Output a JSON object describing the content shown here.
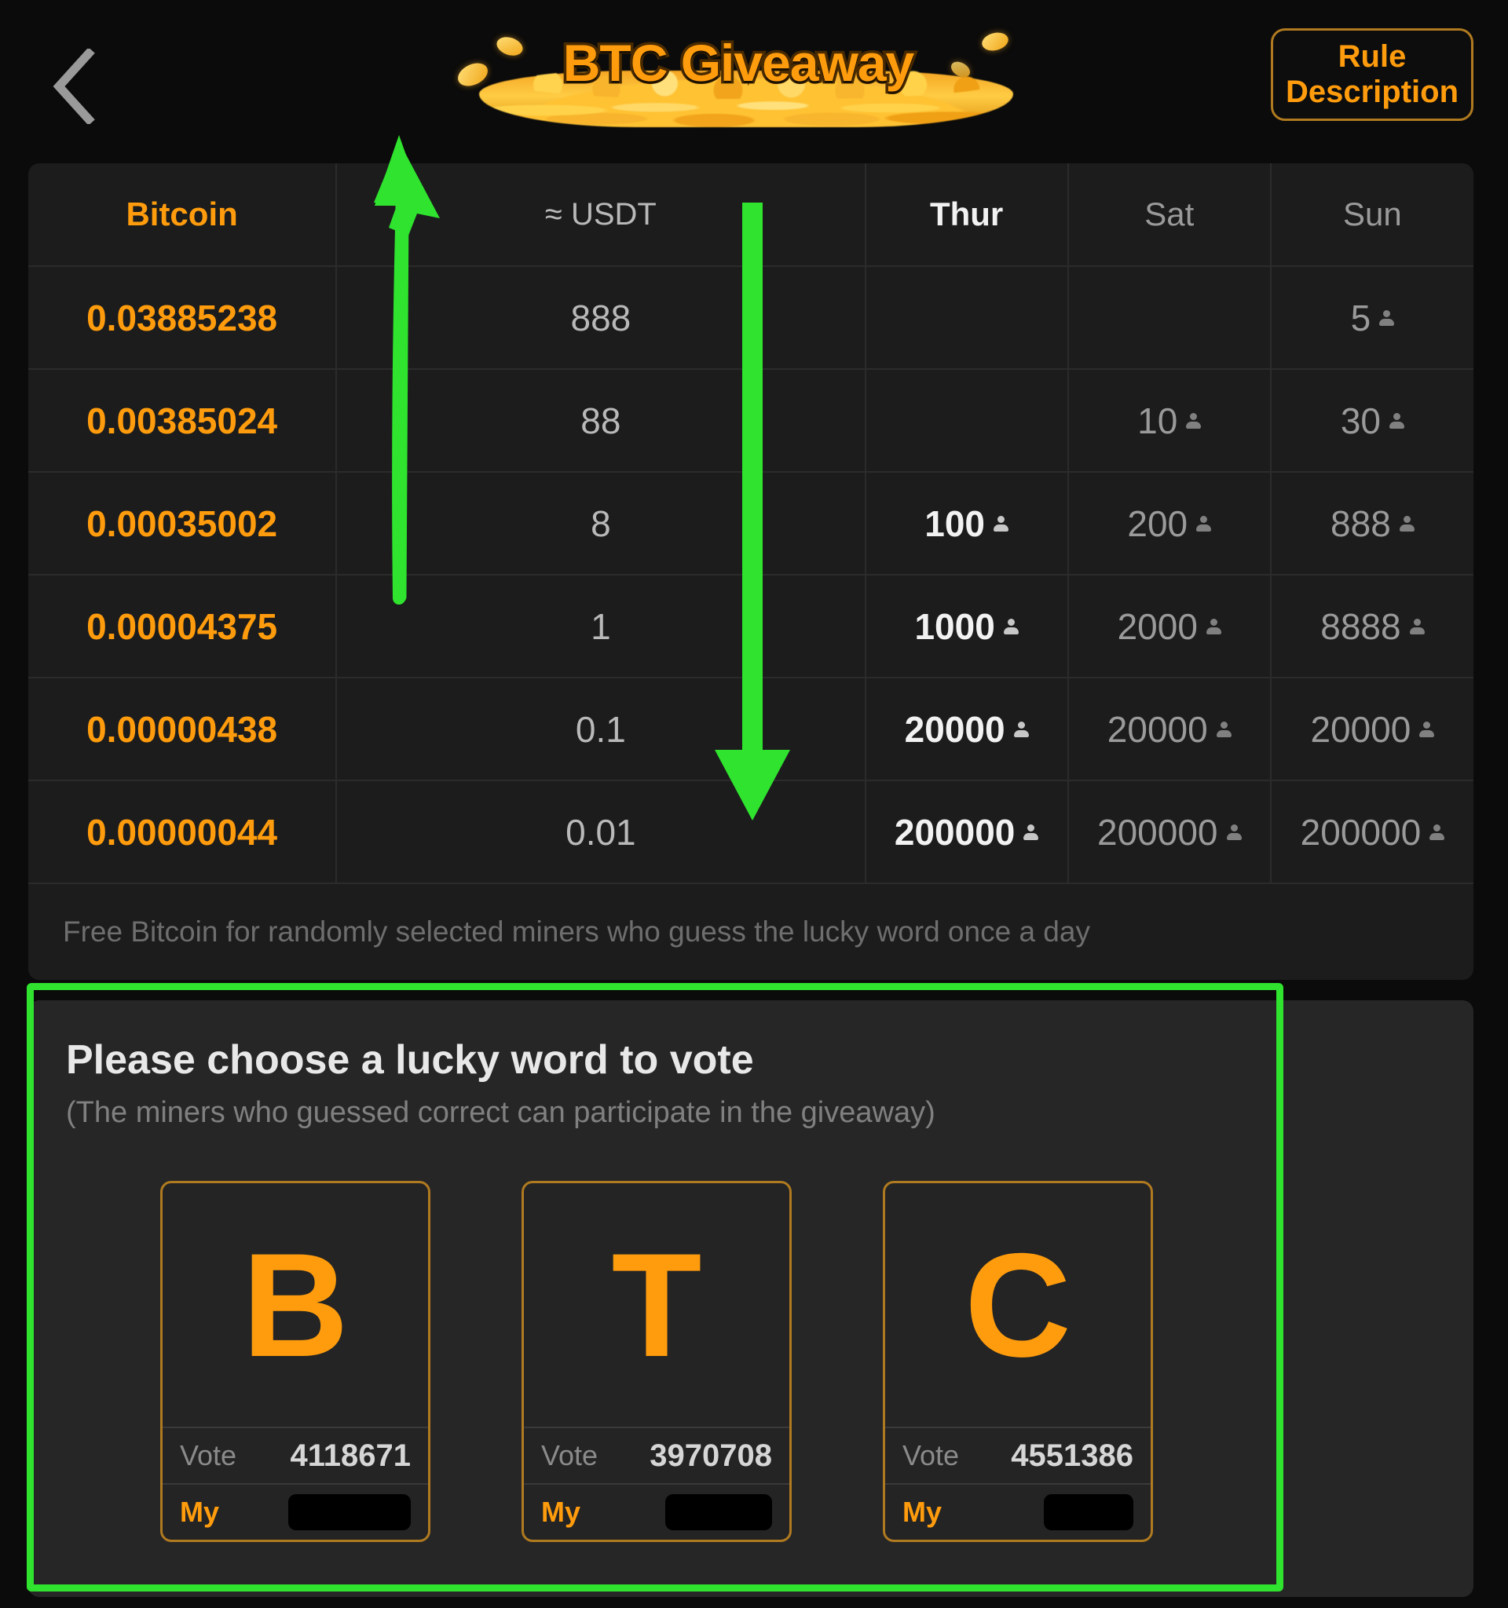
{
  "header": {
    "back_icon": "chevron-left-icon",
    "title": "BTC Giveaway",
    "rule_button_line1": "Rule",
    "rule_button_line2": "Description"
  },
  "table": {
    "columns": [
      "Bitcoin",
      "≈ USDT",
      "Thur",
      "Sat",
      "Sun"
    ],
    "rows": [
      {
        "bitcoin": "0.03885238",
        "usdt": "888",
        "thur": "",
        "sat": "",
        "sun": "5"
      },
      {
        "bitcoin": "0.00385024",
        "usdt": "88",
        "thur": "",
        "sat": "10",
        "sun": "30"
      },
      {
        "bitcoin": "0.00035002",
        "usdt": "8",
        "thur": "100",
        "sat": "200",
        "sun": "888"
      },
      {
        "bitcoin": "0.00004375",
        "usdt": "1",
        "thur": "1000",
        "sat": "2000",
        "sun": "8888"
      },
      {
        "bitcoin": "0.00000438",
        "usdt": "0.1",
        "thur": "20000",
        "sat": "20000",
        "sun": "20000"
      },
      {
        "bitcoin": "0.00000044",
        "usdt": "0.01",
        "thur": "200000",
        "sat": "200000",
        "sun": "200000"
      }
    ],
    "person_icon": "person-icon",
    "note": "Free Bitcoin for randomly selected miners who guess the lucky word once a day"
  },
  "vote": {
    "title": "Please choose a lucky word to vote",
    "subtitle": "(The miners who guessed correct can participate in the giveaway)",
    "vote_label": "Vote",
    "my_label": "My",
    "options": [
      {
        "letter": "B",
        "vote_count": "4118671",
        "my_value": ""
      },
      {
        "letter": "T",
        "vote_count": "3970708",
        "my_value": ""
      },
      {
        "letter": "C",
        "vote_count": "4551386",
        "my_value": ""
      }
    ]
  },
  "colors": {
    "accent_orange": "#ff9c0d",
    "highlight_green": "#2fe32f",
    "card_bg": "#1c1c1c",
    "page_bg": "#0b0b0b",
    "text_dim": "#9a9a9a"
  }
}
